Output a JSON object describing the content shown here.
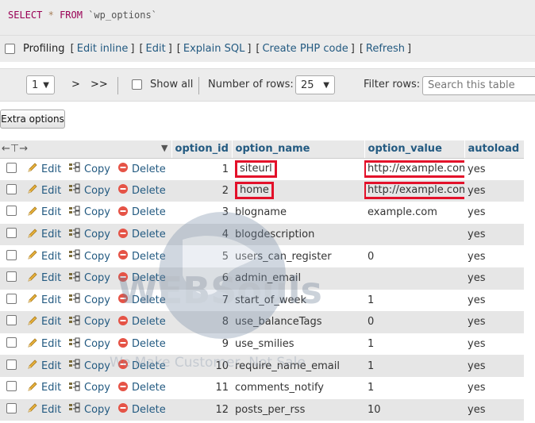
{
  "sql": {
    "select": "SELECT",
    "star": "*",
    "from": "FROM",
    "table": "`wp_options`"
  },
  "profiling": {
    "label": "Profiling",
    "links": [
      "Edit inline",
      "Edit",
      "Explain SQL",
      "Create PHP code",
      "Refresh"
    ]
  },
  "nav": {
    "page": "1",
    "next": ">",
    "last": ">>",
    "show_all": "Show all",
    "rows_label": "Number of rows:",
    "rows_value": "25",
    "filter_label": "Filter rows:",
    "search_placeholder": "Search this table"
  },
  "extra_options": "Extra options",
  "columns": [
    "option_id",
    "option_name",
    "option_value",
    "autoload"
  ],
  "actions": {
    "edit": "Edit",
    "copy": "Copy",
    "delete": "Delete"
  },
  "rows": [
    {
      "id": "1",
      "name": "siteurl",
      "value": "http://example.com",
      "autoload": "yes"
    },
    {
      "id": "2",
      "name": "home",
      "value": "http://example.com",
      "autoload": "yes"
    },
    {
      "id": "3",
      "name": "blogname",
      "value": "example.com",
      "autoload": "yes"
    },
    {
      "id": "4",
      "name": "blogdescription",
      "value": "",
      "autoload": "yes"
    },
    {
      "id": "5",
      "name": "users_can_register",
      "value": "0",
      "autoload": "yes"
    },
    {
      "id": "6",
      "name": "admin_email",
      "value": "",
      "autoload": "yes"
    },
    {
      "id": "7",
      "name": "start_of_week",
      "value": "1",
      "autoload": "yes"
    },
    {
      "id": "8",
      "name": "use_balanceTags",
      "value": "0",
      "autoload": "yes"
    },
    {
      "id": "9",
      "name": "use_smilies",
      "value": "1",
      "autoload": "yes"
    },
    {
      "id": "10",
      "name": "require_name_email",
      "value": "1",
      "autoload": "yes"
    },
    {
      "id": "11",
      "name": "comments_notify",
      "value": "1",
      "autoload": "yes"
    },
    {
      "id": "12",
      "name": "posts_per_rss",
      "value": "10",
      "autoload": "yes"
    }
  ],
  "watermark": {
    "brand": "WEBSouls",
    "tagline": "We Make Customer, Not Sale"
  },
  "colors": {
    "link": "#235a81",
    "highlight": "#e3112a",
    "toolbar": "#ececec",
    "row_alt": "#e6e6e6"
  }
}
